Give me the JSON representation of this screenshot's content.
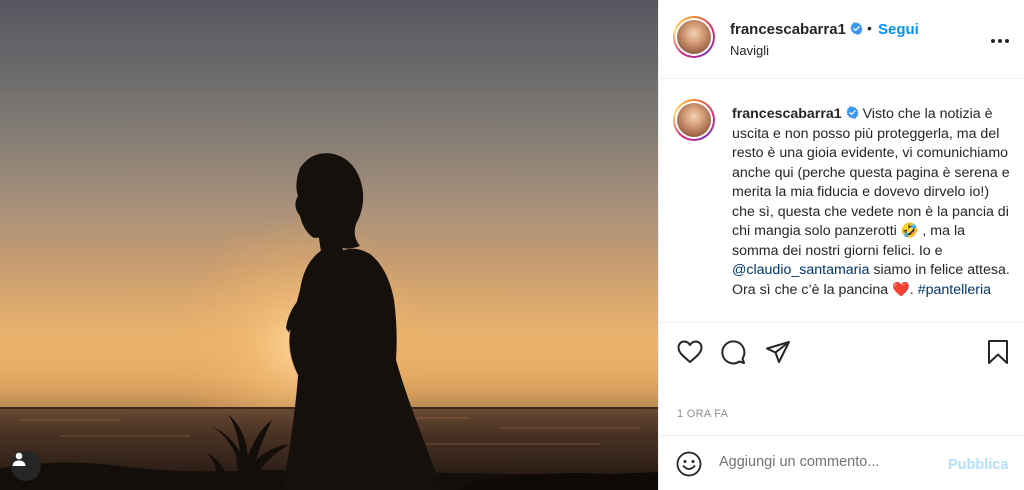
{
  "photo": {
    "alt_icon": "user-icon"
  },
  "header": {
    "username": "francescabarra1",
    "verified": true,
    "separator": "•",
    "follow_label": "Segui",
    "location": "Navigli",
    "more_icon": "more-horizontal-icon"
  },
  "caption": {
    "username": "francescabarra1",
    "text_1": "Visto che la notizia è uscita e non posso più proteggerla, ma del resto è una gioia evidente, vi comunichiamo anche qui (perche questa pagina è serena e merita la mia fiducia e dovevo dirvelo io!) che sì, questa che vedete non è la pancia di chi mangia solo panzerotti",
    "emoji_1": "🤣",
    "text_2": ", ma la somma dei nostri giorni felici. Io e",
    "mention": "@claudio_santamaria",
    "text_3": "siamo in felice attesa. Ora sì che c’è la pancina",
    "emoji_2": "❤️",
    "text_4": ".",
    "hashtag": "#pantelleria"
  },
  "actions": {
    "like_icon": "heart-icon",
    "comment_icon": "comment-icon",
    "share_icon": "share-icon",
    "save_icon": "bookmark-icon"
  },
  "time_ago": "1 ORA FA",
  "comment_box": {
    "emoji_icon": "smiley-icon",
    "placeholder": "Aggiungi un commento...",
    "post_label": "Pubblica"
  },
  "colors": {
    "link_blue": "#0095f6",
    "post_disabled": "#b2dffc",
    "hashtag": "#00376b",
    "muted": "#8e8e8e"
  }
}
